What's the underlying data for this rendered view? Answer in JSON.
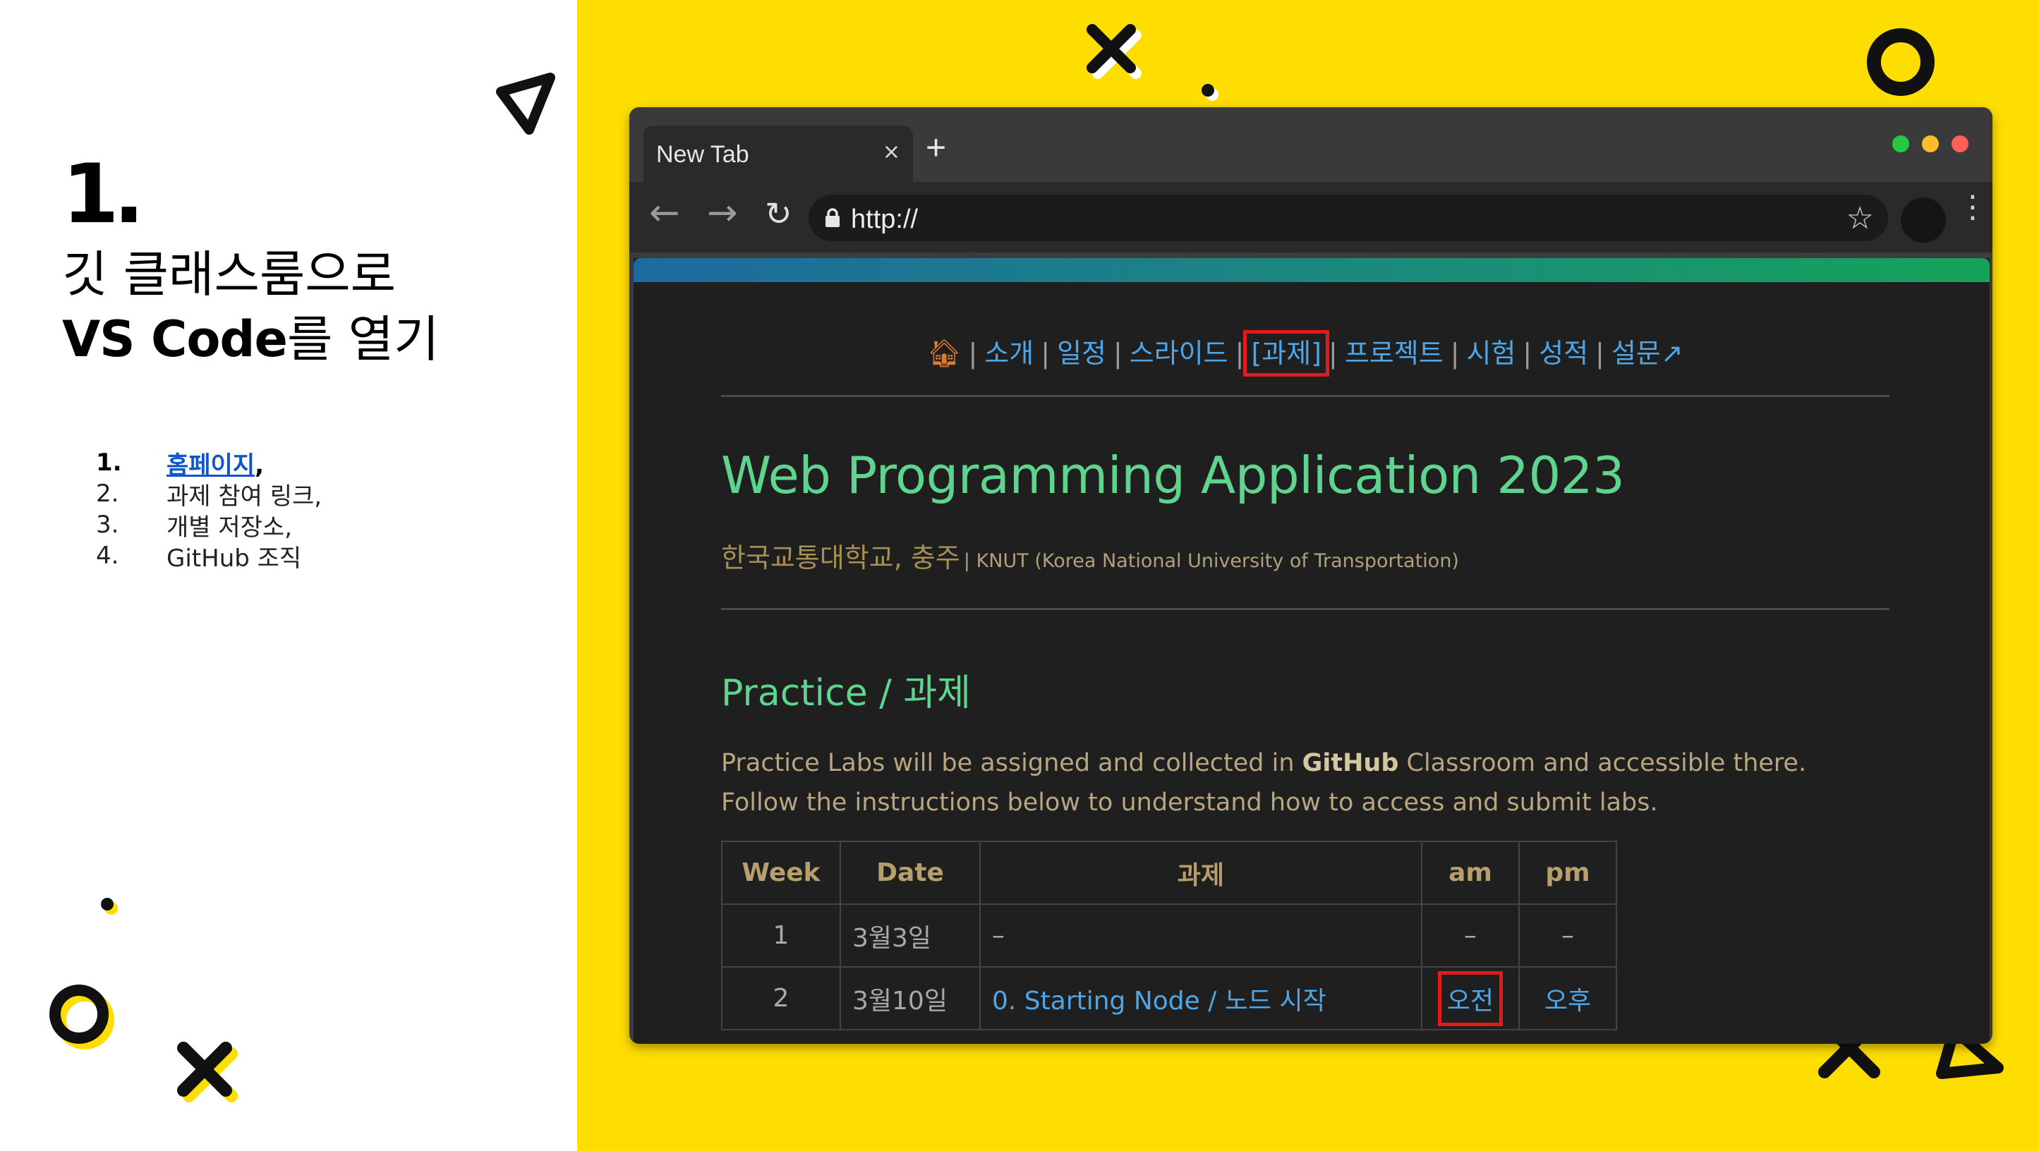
{
  "slide": {
    "number": "1.",
    "title_line1": "깃 클래스룸으로",
    "title_line2_bold": "VS Code",
    "title_line2_light": "를 열기",
    "steps": [
      {
        "num": "1.",
        "link": "홈페이지",
        "suffix": ","
      },
      {
        "num": "2.",
        "text": "과제 참여 링크,"
      },
      {
        "num": "3.",
        "text": "개별 저장소,"
      },
      {
        "num": "4.",
        "text": "GitHub 조직"
      }
    ]
  },
  "browser": {
    "tab_title": "New Tab",
    "tab_close": "×",
    "new_tab": "+",
    "url": "http://",
    "window_dots": [
      "#27c93f",
      "#ffbd2e",
      "#ff5f56"
    ]
  },
  "page": {
    "nav": {
      "home_icon": "home-icon",
      "items": [
        "소개",
        "일정",
        "스라이드",
        "[과제]",
        "프로젝트",
        "시험",
        "성적",
        "설문↗"
      ],
      "highlighted": "[과제]"
    },
    "title": "Web Programming Application 2023",
    "subtitle_ko": "한국교통대학교, 충주",
    "subtitle_en": "| KNUT (Korea National University of Transportation)",
    "section_title": "Practice / 과제",
    "description_before": "Practice Labs will be assigned and collected in ",
    "description_bold": "GitHub",
    "description_after": " Classroom and accessible there. Follow the instructions below to understand how to access and submit labs.",
    "table": {
      "headers": [
        "Week",
        "Date",
        "과제",
        "am",
        "pm"
      ],
      "rows": [
        {
          "week": "1",
          "date": "3월3일",
          "task": "–",
          "am": "–",
          "pm": "–"
        },
        {
          "week": "2",
          "date": "3월10일",
          "task": "0. Starting Node / 노드 시작",
          "am": "오전",
          "pm": "오후"
        }
      ]
    }
  },
  "colors": {
    "yellow": "#fedd00",
    "accent_green": "#5fd48e",
    "link_blue": "#4ea6e8",
    "highlight_red": "#e01b1b"
  }
}
